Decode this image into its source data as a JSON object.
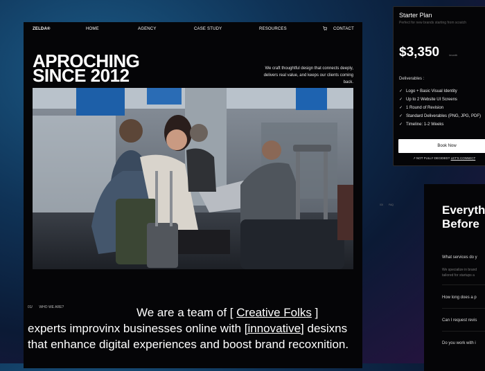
{
  "nav": {
    "logo": "ZELDA®",
    "items": [
      "HOME",
      "AGENCY",
      "CASE STUDY",
      "RESOURCES",
      "CONTACT"
    ]
  },
  "hero": {
    "title_line1": "APROCHING",
    "title_line2": "SINCE 2012",
    "description": "We craft thoughtful design that connects deeply, delivers real value, and keeps our clients coming back."
  },
  "about": {
    "number": "01/",
    "label": "WHO WE ARE?",
    "text_pre": "We are a team of [ ",
    "highlight1": "Creative Folks",
    "text_mid": " ] experts improvinx businesses online with ",
    "highlight2": "[innovative]",
    "text_post": " desixns that enhance digital experiences and boost brand recoxnition."
  },
  "pricing": {
    "plan": "Starter Plan",
    "subtitle": "Perfect for new brands starting from scratch",
    "amount": "$3,350",
    "period": "/month",
    "deliverables_label": "Deliverables :",
    "items": [
      "Logo + Basic Visual Identity",
      "Up to 2 Website UI Screens",
      "1 Round of Revision",
      "Standard Deliverables (PNG, JPG, PDF)",
      "Timeline: 1-2 Weeks"
    ],
    "button": "Book Now",
    "note_pre": "NOT FULLY DECIDED?",
    "note_link": "LET'S CONNECT"
  },
  "faq": {
    "title_line1": "Everyth",
    "title_line2": "Before",
    "tags": [
      "03/",
      "FAQ"
    ],
    "items": [
      {
        "question": "What services do y",
        "answer_line1": "We specialize in brand",
        "answer_line2": "tailored for startups a"
      },
      {
        "question": "How long does a p"
      },
      {
        "question": "Can I request revis"
      },
      {
        "question": "Do you work with i"
      }
    ]
  },
  "colors": {
    "card_bg": "#050507",
    "button_bg": "#ffffff",
    "text": "#ffffff",
    "muted": "#777777"
  }
}
